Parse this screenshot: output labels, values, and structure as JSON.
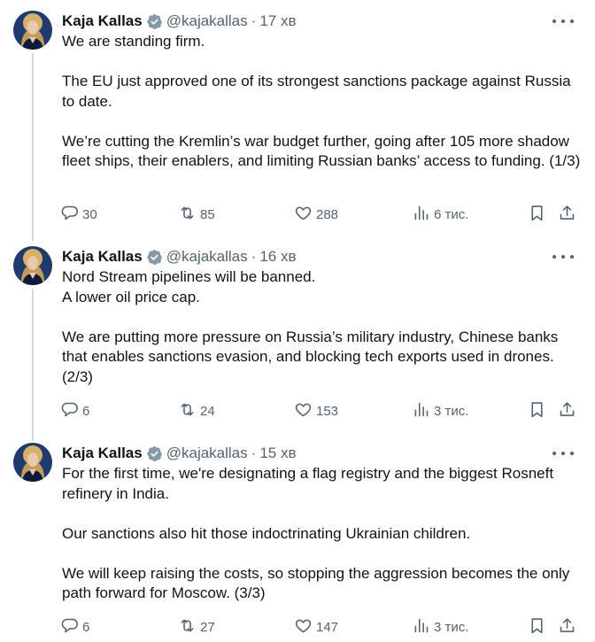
{
  "tweets": [
    {
      "author_name": "Kaja Kallas",
      "handle": "@kajakallas",
      "separator": "·",
      "time": "17 хв",
      "paragraphs": [
        "We are standing firm.",
        "The EU just approved one of its strongest sanctions package against Russia to date.",
        "We’re cutting the Kremlin’s war budget further, going after 105 more shadow fleet ships, their enablers, and limiting Russian banks’ access to funding. (1/3)"
      ],
      "replies": "30",
      "reposts": "85",
      "likes": "288",
      "views": "6 тис."
    },
    {
      "author_name": "Kaja Kallas",
      "handle": "@kajakallas",
      "separator": "·",
      "time": "16 хв",
      "paragraphs": [
        "Nord Stream pipelines will be banned.\nA lower oil price cap.",
        "We are putting more pressure on Russia’s military industry, Chinese banks that enables sanctions evasion, and blocking tech exports used in drones. (2/3)"
      ],
      "replies": "6",
      "reposts": "24",
      "likes": "153",
      "views": "3 тис."
    },
    {
      "author_name": "Kaja Kallas",
      "handle": "@kajakallas",
      "separator": "·",
      "time": "15 хв",
      "paragraphs": [
        "For the first time, we're designating a flag registry and the biggest Rosneft refinery in India.",
        "Our sanctions also hit those indoctrinating Ukrainian children.",
        "We will keep raising the costs, so stopping the aggression becomes the only path forward for Moscow. (3/3)"
      ],
      "replies": "6",
      "reposts": "27",
      "likes": "147",
      "views": "3 тис."
    }
  ],
  "icons": {
    "verified": "verified-badge-icon",
    "more": "more-icon",
    "reply": "reply-icon",
    "repost": "repost-icon",
    "like": "like-icon",
    "views": "views-icon",
    "bookmark": "bookmark-icon",
    "share": "share-icon"
  },
  "colors": {
    "text": "#0f1419",
    "secondary": "#536471",
    "thread_line": "#cfd9de"
  }
}
